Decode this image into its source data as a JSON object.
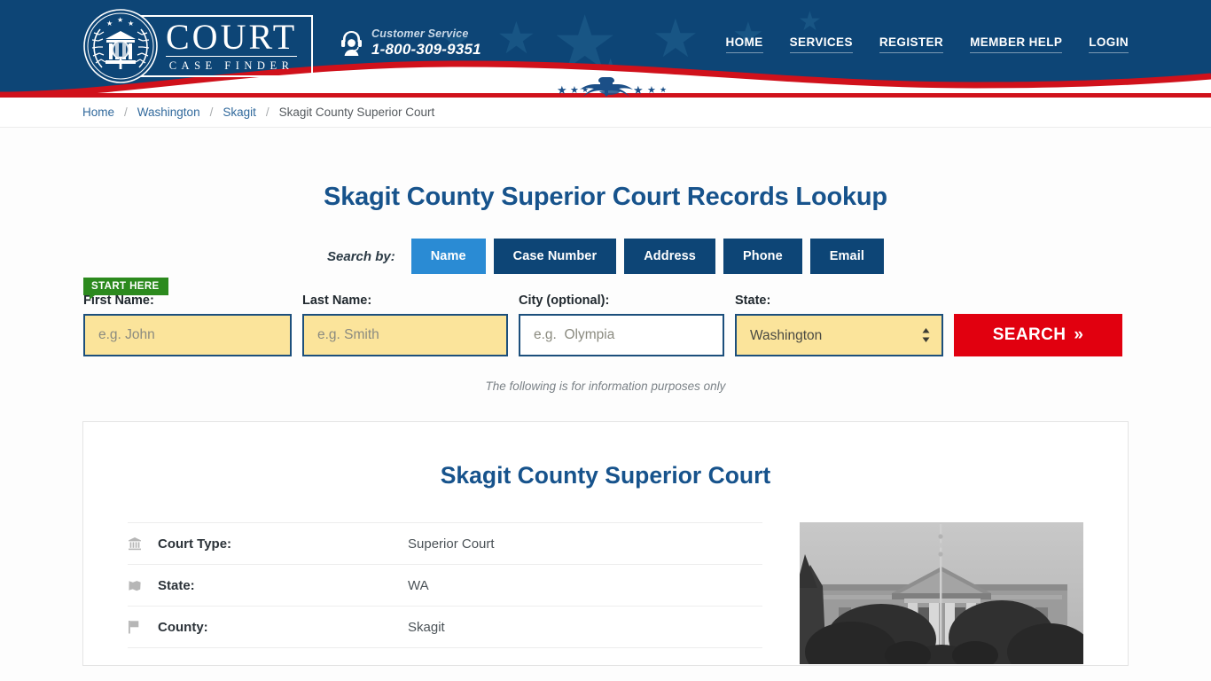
{
  "header": {
    "logo": {
      "brand_main": "COURT",
      "brand_sub": "CASE FINDER"
    },
    "customer_service": {
      "label": "Customer Service",
      "phone": "1-800-309-9351"
    },
    "nav": [
      {
        "label": "HOME"
      },
      {
        "label": "SERVICES"
      },
      {
        "label": "REGISTER"
      },
      {
        "label": "MEMBER HELP"
      },
      {
        "label": "LOGIN"
      }
    ],
    "colors": {
      "navy": "#0d4576",
      "red": "#d0111b",
      "star": "#185584"
    }
  },
  "breadcrumb": {
    "items": [
      {
        "label": "Home",
        "link": true
      },
      {
        "label": "Washington",
        "link": true
      },
      {
        "label": "Skagit",
        "link": true
      },
      {
        "label": "Skagit County Superior Court",
        "link": false
      }
    ],
    "separator": "/"
  },
  "main": {
    "page_title": "Skagit County Superior Court Records Lookup",
    "search_by_label": "Search by:",
    "tabs": [
      {
        "label": "Name",
        "active": true
      },
      {
        "label": "Case Number",
        "active": false
      },
      {
        "label": "Address",
        "active": false
      },
      {
        "label": "Phone",
        "active": false
      },
      {
        "label": "Email",
        "active": false
      }
    ],
    "start_here_badge": "START HERE",
    "form": {
      "first_name": {
        "label": "First Name:",
        "value": "",
        "placeholder": "e.g. John"
      },
      "last_name": {
        "label": "Last Name:",
        "value": "",
        "placeholder": "e.g. Smith"
      },
      "city": {
        "label": "City (optional):",
        "value": "",
        "placeholder": "e.g.  Olympia"
      },
      "state": {
        "label": "State:",
        "value": "Washington",
        "options": [
          "Washington"
        ]
      },
      "search_button": "SEARCH",
      "search_button_icon": "»"
    },
    "disclaimer": "The following is for information purposes only"
  },
  "card": {
    "title": "Skagit County Superior Court",
    "rows": [
      {
        "icon": "bank-icon",
        "key": "Court Type:",
        "value": "Superior Court"
      },
      {
        "icon": "map-icon",
        "key": "State:",
        "value": "WA"
      },
      {
        "icon": "flag-icon",
        "key": "County:",
        "value": "Skagit"
      }
    ],
    "photo_alt": "courthouse-photo"
  },
  "accent_colors": {
    "heading_blue": "#17538c",
    "tab_active_blue": "#2a8bd4",
    "tab_blue": "#0d4576",
    "search_red": "#e1000f",
    "field_yellow": "#fbe49b",
    "badge_green": "#2c8a1e"
  }
}
